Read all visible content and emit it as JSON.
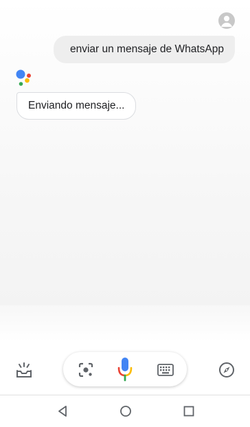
{
  "conversation": {
    "user_message": "enviar un mensaje de WhatsApp",
    "assistant_reply": "Enviando mensaje..."
  },
  "icons": {
    "user_avatar": "account-circle-icon",
    "assistant_logo": "google-assistant-dots-icon",
    "snapshot": "snapshot-tray-icon",
    "lens": "google-lens-icon",
    "mic": "microphone-icon",
    "keyboard": "keyboard-icon",
    "explore": "compass-icon",
    "nav_back": "triangle-back-icon",
    "nav_home": "circle-home-icon",
    "nav_recents": "square-recents-icon"
  },
  "colors": {
    "google_blue": "#4285F4",
    "google_red": "#EA4335",
    "google_yellow": "#FBBC05",
    "google_green": "#34A853",
    "icon_gray": "#5f6368",
    "user_bubble_bg": "#eeeeee",
    "text": "#202124"
  }
}
